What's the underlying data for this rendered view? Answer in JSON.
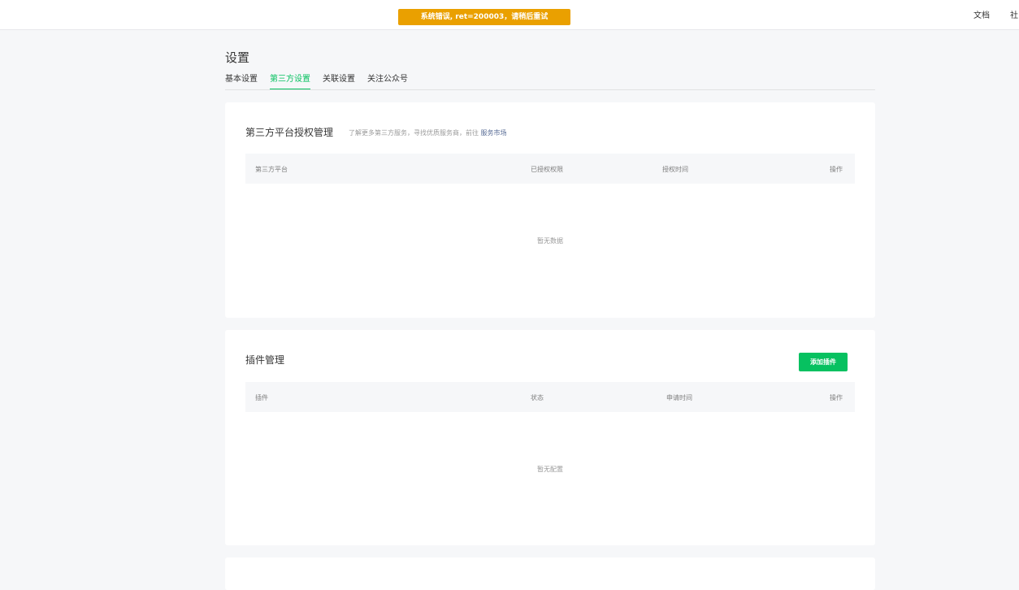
{
  "topbar": {
    "toast": "系统错误, ret=200003，请稍后重试",
    "nav_doc": "文档",
    "nav_community": "社"
  },
  "page": {
    "title": "设置",
    "tabs": [
      "基本设置",
      "第三方设置",
      "关联设置",
      "关注公众号"
    ],
    "active_tab": "第三方设置"
  },
  "third_party": {
    "title": "第三方平台授权管理",
    "desc": "了解更多第三方服务，寻找优质服务商，前往",
    "link": "服务市场",
    "columns": [
      "第三方平台",
      "已授权权限",
      "授权时间",
      "操作"
    ],
    "empty": "暂无数据"
  },
  "plugins": {
    "title": "插件管理",
    "add_button": "添加插件",
    "columns": [
      "插件",
      "状态",
      "申请时间",
      "操作"
    ],
    "empty": "暂无配置"
  },
  "colors": {
    "accent": "#07c160",
    "toast_bg": "#eaa000",
    "link": "#576b95",
    "background": "#f6f7f9"
  }
}
